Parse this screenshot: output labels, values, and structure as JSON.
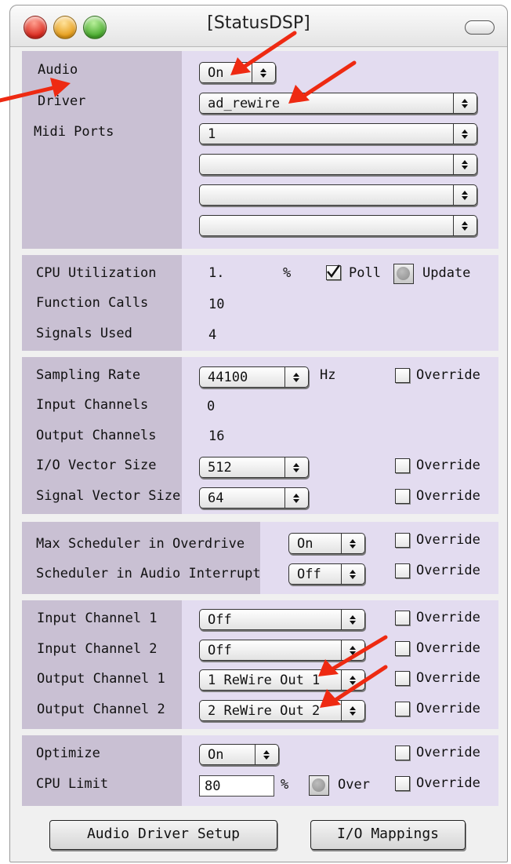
{
  "window": {
    "title": "[StatusDSP]"
  },
  "audio": {
    "audio_label": "Audio",
    "audio_value": "On",
    "driver_label": "Driver",
    "driver_value": "ad_rewire",
    "midi_label": "Midi Ports",
    "midi_values": [
      "1",
      "",
      "",
      ""
    ]
  },
  "cpu": {
    "util_label": "CPU Utilization",
    "util_value": "1.",
    "util_unit": "%",
    "poll_label": "Poll",
    "poll_checked": true,
    "update_label": "Update",
    "calls_label": "Function Calls",
    "calls_value": "10",
    "signals_label": "Signals Used",
    "signals_value": "4"
  },
  "sampling": {
    "rate_label": "Sampling Rate",
    "rate_value": "44100",
    "rate_unit": "Hz",
    "in_label": "Input Channels",
    "in_value": "0",
    "out_label": "Output Channels",
    "out_value": "16",
    "io_label": "I/O Vector Size",
    "io_value": "512",
    "sig_label": "Signal Vector Size",
    "sig_value": "64"
  },
  "scheduler": {
    "overdrive_label": "Max Scheduler in Overdrive",
    "overdrive_value": "On",
    "interrupt_label": "Scheduler in Audio Interrupt",
    "interrupt_value": "Off"
  },
  "channels": {
    "in1_label": "Input Channel 1",
    "in1_value": "Off",
    "in2_label": "Input Channel 2",
    "in2_value": "Off",
    "out1_label": "Output Channel 1",
    "out1_value": "1 ReWire Out 1",
    "out2_label": "Output Channel 2",
    "out2_value": "2 ReWire Out 2"
  },
  "optimize": {
    "opt_label": "Optimize",
    "opt_value": "On",
    "limit_label": "CPU Limit",
    "limit_value": "80",
    "limit_unit": "%",
    "over_label": "Over"
  },
  "override_label": "Override",
  "buttons": {
    "driver_setup": "Audio Driver Setup",
    "io_mappings": "I/O Mappings"
  },
  "colors": {
    "panel": "#e3dcf0",
    "label_column": "#c9c0d3",
    "annotation_arrow": "#ee2a12"
  },
  "icons": {
    "popup": "updown-arrow-icon",
    "check": "checkmark-icon",
    "annotation": "red-arrow-icon"
  }
}
